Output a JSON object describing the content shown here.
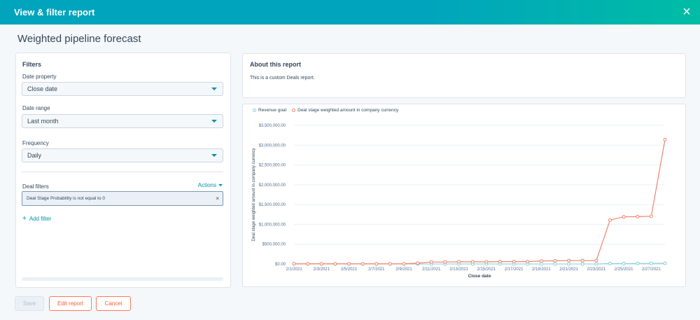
{
  "header": {
    "title": "View & filter report",
    "close_icon": "×"
  },
  "page_title": "Weighted pipeline forecast",
  "filters": {
    "heading": "Filters",
    "date_property_label": "Date property",
    "date_property_value": "Close date",
    "date_range_label": "Date range",
    "date_range_value": "Last month",
    "frequency_label": "Frequency",
    "frequency_value": "Daily",
    "deal_filters_label": "Deal filters",
    "actions_label": "Actions",
    "chip_text": "Deal Stage Probability is not equal to 0",
    "chip_close": "×",
    "add_filter_label": "Add filter",
    "add_filter_icon": "+"
  },
  "about": {
    "title": "About this report",
    "text": "This is a custom Deals report."
  },
  "buttons": {
    "save": "Save",
    "edit": "Edit report",
    "cancel": "Cancel"
  },
  "colors": {
    "accent": "#00a4bd",
    "series_goal": "#7fd1de",
    "series_amount": "#f2836b",
    "cta": "#ff7a59"
  },
  "chart_data": {
    "type": "line",
    "xlabel": "Close date",
    "ylabel": "Deal stage weighted amount in company currency",
    "ylim": [
      0,
      3500000
    ],
    "y_ticks": [
      "$0.00",
      "$500,000.00",
      "$1,000,000.00",
      "$1,500,000.00",
      "$2,000,000.00",
      "$2,500,000.00",
      "$3,000,000.00",
      "$3,500,000.00"
    ],
    "x_tick_labels": [
      "2/1/2021",
      "2/3/2021",
      "2/5/2021",
      "2/7/2021",
      "2/9/2021",
      "2/11/2021",
      "2/13/2021",
      "2/15/2021",
      "2/17/2021",
      "2/19/2021",
      "2/21/2021",
      "2/23/2021",
      "2/25/2021",
      "2/27/2021"
    ],
    "x": [
      "2/1/2021",
      "2/2/2021",
      "2/3/2021",
      "2/4/2021",
      "2/5/2021",
      "2/6/2021",
      "2/7/2021",
      "2/8/2021",
      "2/9/2021",
      "2/10/2021",
      "2/11/2021",
      "2/12/2021",
      "2/13/2021",
      "2/14/2021",
      "2/15/2021",
      "2/16/2021",
      "2/17/2021",
      "2/18/2021",
      "2/19/2021",
      "2/20/2021",
      "2/21/2021",
      "2/22/2021",
      "2/23/2021",
      "2/24/2021",
      "2/25/2021",
      "2/26/2021",
      "2/27/2021",
      "2/28/2021"
    ],
    "legend": "top-left",
    "series": [
      {
        "name": "Revenue goal",
        "color": "#7fd1de",
        "values": [
          0,
          0,
          0,
          0,
          0,
          0,
          0,
          0,
          0,
          0,
          0,
          0,
          0,
          0,
          0,
          0,
          0,
          0,
          0,
          0,
          0,
          0,
          0,
          10000,
          12000,
          14000,
          16000,
          18000
        ]
      },
      {
        "name": "Deal stage weighted amount in company currency",
        "color": "#f2836b",
        "values": [
          5000,
          5000,
          5000,
          5000,
          5000,
          5000,
          5000,
          5000,
          5000,
          20000,
          50000,
          50000,
          55000,
          55000,
          55000,
          60000,
          60000,
          60000,
          75000,
          80000,
          85000,
          85000,
          85000,
          1110000,
          1190000,
          1195000,
          1205000,
          3140000
        ]
      }
    ]
  }
}
